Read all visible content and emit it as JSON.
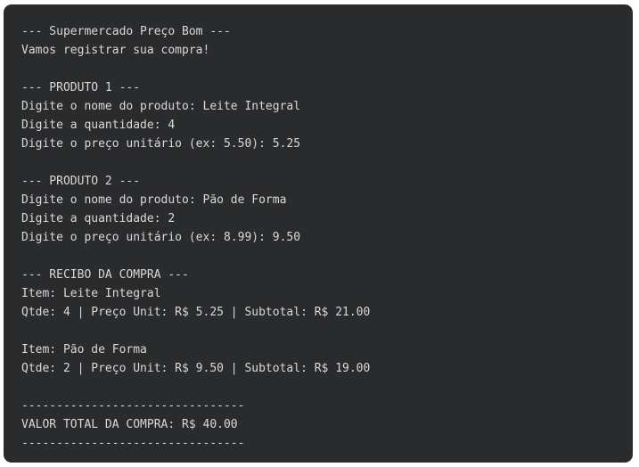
{
  "terminal": {
    "lines": [
      "--- Supermercado Preço Bom ---",
      "Vamos registrar sua compra!",
      "",
      "--- PRODUTO 1 ---",
      "Digite o nome do produto: Leite Integral",
      "Digite a quantidade: 4",
      "Digite o preço unitário (ex: 5.50): 5.25",
      "",
      "--- PRODUTO 2 ---",
      "Digite o nome do produto: Pão de Forma",
      "Digite a quantidade: 2",
      "Digite o preço unitário (ex: 8.99): 9.50",
      "",
      "--- RECIBO DA COMPRA ---",
      "Item: Leite Integral",
      "Qtde: 4 | Preço Unit: R$ 5.25 | Subtotal: R$ 21.00",
      "",
      "Item: Pão de Forma",
      "Qtde: 2 | Preço Unit: R$ 9.50 | Subtotal: R$ 19.00",
      "",
      "--------------------------------",
      "VALOR TOTAL DA COMPRA: R$ 40.00",
      "--------------------------------"
    ]
  }
}
